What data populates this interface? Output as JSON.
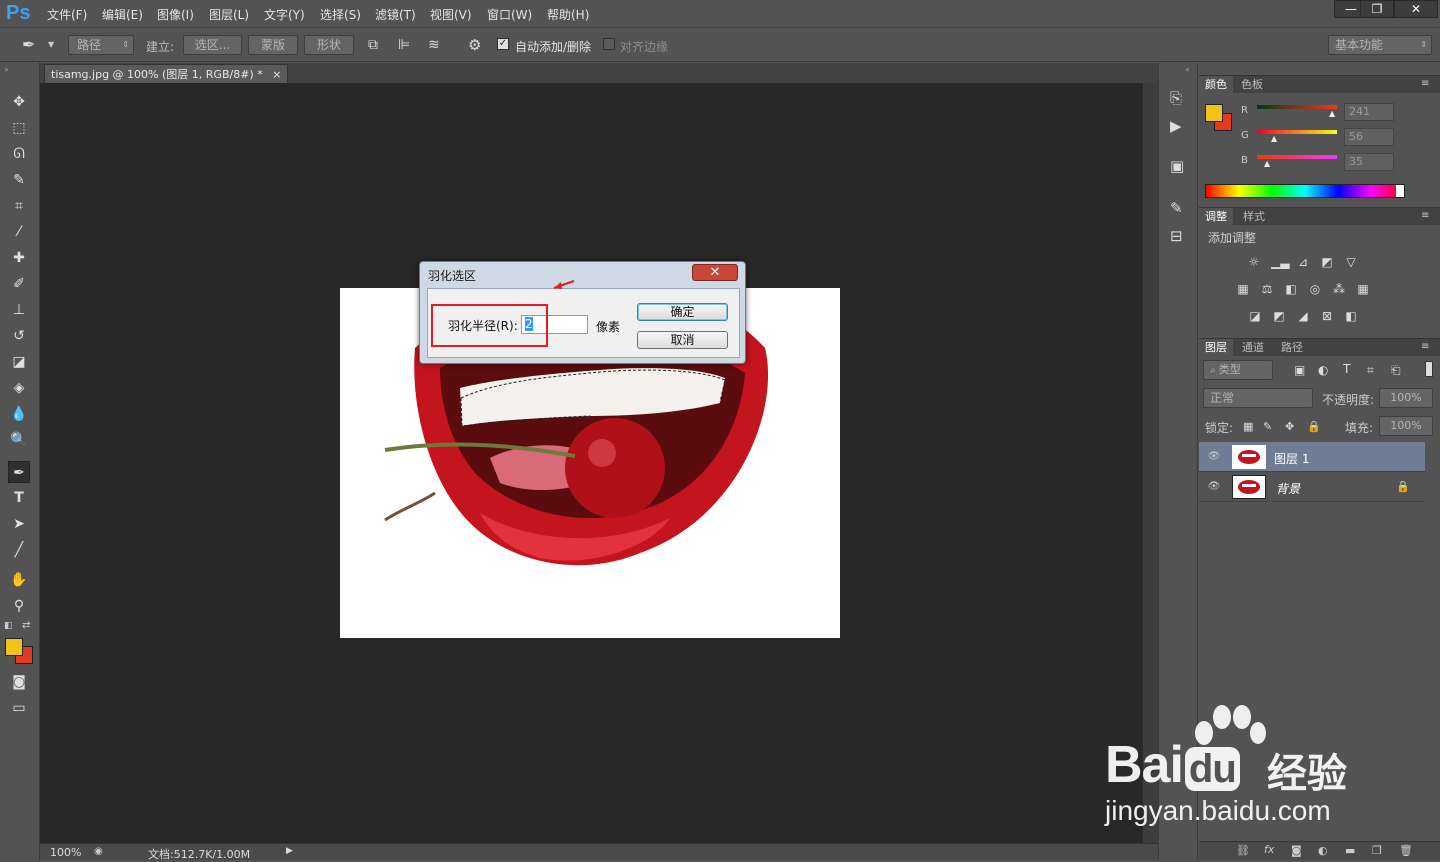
{
  "app": {
    "logo": "Ps"
  },
  "menu": [
    "文件(F)",
    "编辑(E)",
    "图像(I)",
    "图层(L)",
    "文字(Y)",
    "选择(S)",
    "滤镜(T)",
    "视图(V)",
    "窗口(W)",
    "帮助(H)"
  ],
  "window_controls": {
    "minimize": "—",
    "restore": "❐",
    "close": "✕"
  },
  "options": {
    "mode": "路径",
    "build_label": "建立:",
    "selection_btn": "选区...",
    "mask_btn": "蒙版",
    "shape_btn": "形状",
    "auto_add_delete": "自动添加/删除",
    "auto_add_delete_checked": true,
    "align_edges": "对齐边缘",
    "align_edges_checked": false,
    "workspace": "基本功能"
  },
  "document": {
    "tab_title": "tisamg.jpg @ 100% (图层 1, RGB/8#) *",
    "tab_close": "×",
    "zoom": "100%",
    "doc_info": "文档:512.7K/1.00M"
  },
  "dialog": {
    "title": "羽化选区",
    "close": "✕",
    "radius_label": "羽化半径(R):",
    "radius_value": "2",
    "unit": "像素",
    "ok": "确定",
    "cancel": "取消"
  },
  "color_panel": {
    "tabs": [
      "颜色",
      "色板"
    ],
    "channels": [
      {
        "label": "R",
        "value": "241",
        "level": 0.945
      },
      {
        "label": "G",
        "value": "56",
        "level": 0.22
      },
      {
        "label": "B",
        "value": "35",
        "level": 0.137
      }
    ],
    "foreground": "#f1c21b",
    "background": "#e23a23"
  },
  "adjust_panel": {
    "tabs": [
      "调整",
      "样式"
    ],
    "title": "添加调整"
  },
  "layers_panel": {
    "tabs": [
      "图层",
      "通道",
      "路径"
    ],
    "filter": "类型",
    "blend_mode": "正常",
    "opacity_label": "不透明度:",
    "opacity": "100%",
    "lock_label": "锁定:",
    "fill_label": "填充:",
    "fill": "100%",
    "layers": [
      {
        "name": "图层 1",
        "selected": true,
        "locked": false
      },
      {
        "name": "背景",
        "selected": false,
        "locked": true
      }
    ]
  },
  "watermark": {
    "brand": "Bai",
    "brand2": "du",
    "cn": "经验",
    "url": "jingyan.baidu.com"
  }
}
